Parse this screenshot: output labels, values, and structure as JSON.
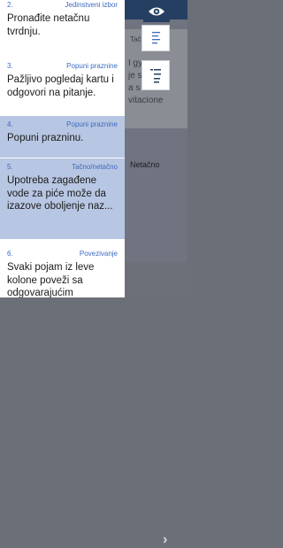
{
  "background": {
    "lines": [
      "Tačno/n",
      "I gy",
      "je s",
      "a s",
      "vitacione"
    ],
    "netacno_label": "Netačno"
  },
  "drawer": {
    "items": [
      {
        "number": "2.",
        "type": "Jedinstveni izbor",
        "text": "Pronađite netačnu tvrdnju."
      },
      {
        "number": "3.",
        "type": "Popuni praznine",
        "text": "Pažljivo pogledaj kartu i odgovori na pitanje."
      },
      {
        "number": "4.",
        "type": "Popuni praznine",
        "text": "Popuni prazninu."
      },
      {
        "number": "5.",
        "type": "Tačno/netačno",
        "text": "Upotreba zagađene vode za piće može da izazove oboljenje naz..."
      },
      {
        "number": "6.",
        "type": "Povezivanje",
        "text": "Svaki pojam iz leve kolone poveži sa odgovarajućim"
      }
    ]
  },
  "tools": {
    "eye_icon": "eye-icon",
    "outline_icon": "outline-list-icon",
    "list_icon": "list-icon"
  },
  "nav": {
    "next_glyph": "›"
  },
  "colors": {
    "header": "#253f63",
    "highlight": "#b7c6e2",
    "meta": "#3d6bc0"
  }
}
